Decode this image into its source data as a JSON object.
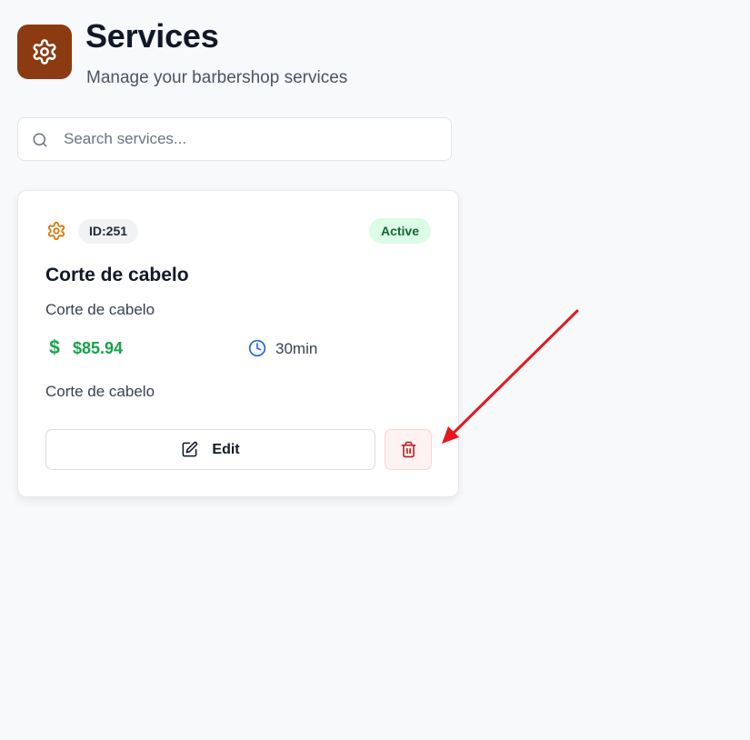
{
  "header": {
    "title": "Services",
    "subtitle": "Manage your barbershop services",
    "icon": "gear-icon",
    "icon_bg_color": "#8b3a12"
  },
  "search": {
    "placeholder": "Search services...",
    "value": "",
    "icon": "search-icon"
  },
  "services": [
    {
      "id_label": "ID:251",
      "status": "Active",
      "name": "Corte de cabelo",
      "description": "Corte de cabelo",
      "price_icon": "$",
      "price": "$85.94",
      "duration": "30min",
      "notes": "Corte de cabelo",
      "edit_label": "Edit",
      "delete_icon": "trash-icon"
    }
  ],
  "colors": {
    "accent": "#8b3a12",
    "gear_orange": "#d97706",
    "price_green": "#16a34a",
    "status_bg": "#dcfce7",
    "status_text": "#166534",
    "clock_blue": "#2563eb",
    "delete_red": "#b91c1c",
    "annotation_red": "#e8161c"
  }
}
